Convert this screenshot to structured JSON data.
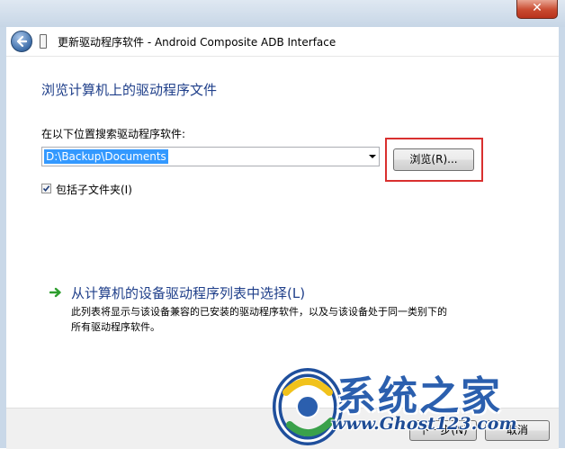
{
  "window": {
    "title": "更新驱动程序软件 - Android Composite ADB Interface",
    "close_glyph": "✕"
  },
  "main": {
    "heading": "浏览计算机上的驱动程序文件",
    "search_label": "在以下位置搜索驱动程序软件:",
    "path_value": "D:\\Backup\\Documents",
    "browse_label": "浏览(R)...",
    "include_subfolders_label": "包括子文件夹(I)",
    "include_subfolders_checked": true
  },
  "pick": {
    "link_label": "从计算机的设备驱动程序列表中选择(L)",
    "description_line1": "此列表将显示与该设备兼容的已安装的驱动程序软件，以及与该设备处于同一类别下的",
    "description_line2": "所有驱动程序软件。"
  },
  "footer": {
    "next_label": "下一步(N)",
    "cancel_label": "取消"
  },
  "watermark": {
    "brand_cn": "系统之家",
    "url": "www.Ghost123.com"
  },
  "colors": {
    "heading": "#1f3f8a",
    "highlight_border": "#d9302f",
    "selection": "#3399ff",
    "arrow_green": "#2e9e2e"
  },
  "icons": {
    "back": "back-arrow-icon",
    "device": "usb-device-icon",
    "dropdown": "chevron-down-icon",
    "link": "green-arrow-icon"
  }
}
